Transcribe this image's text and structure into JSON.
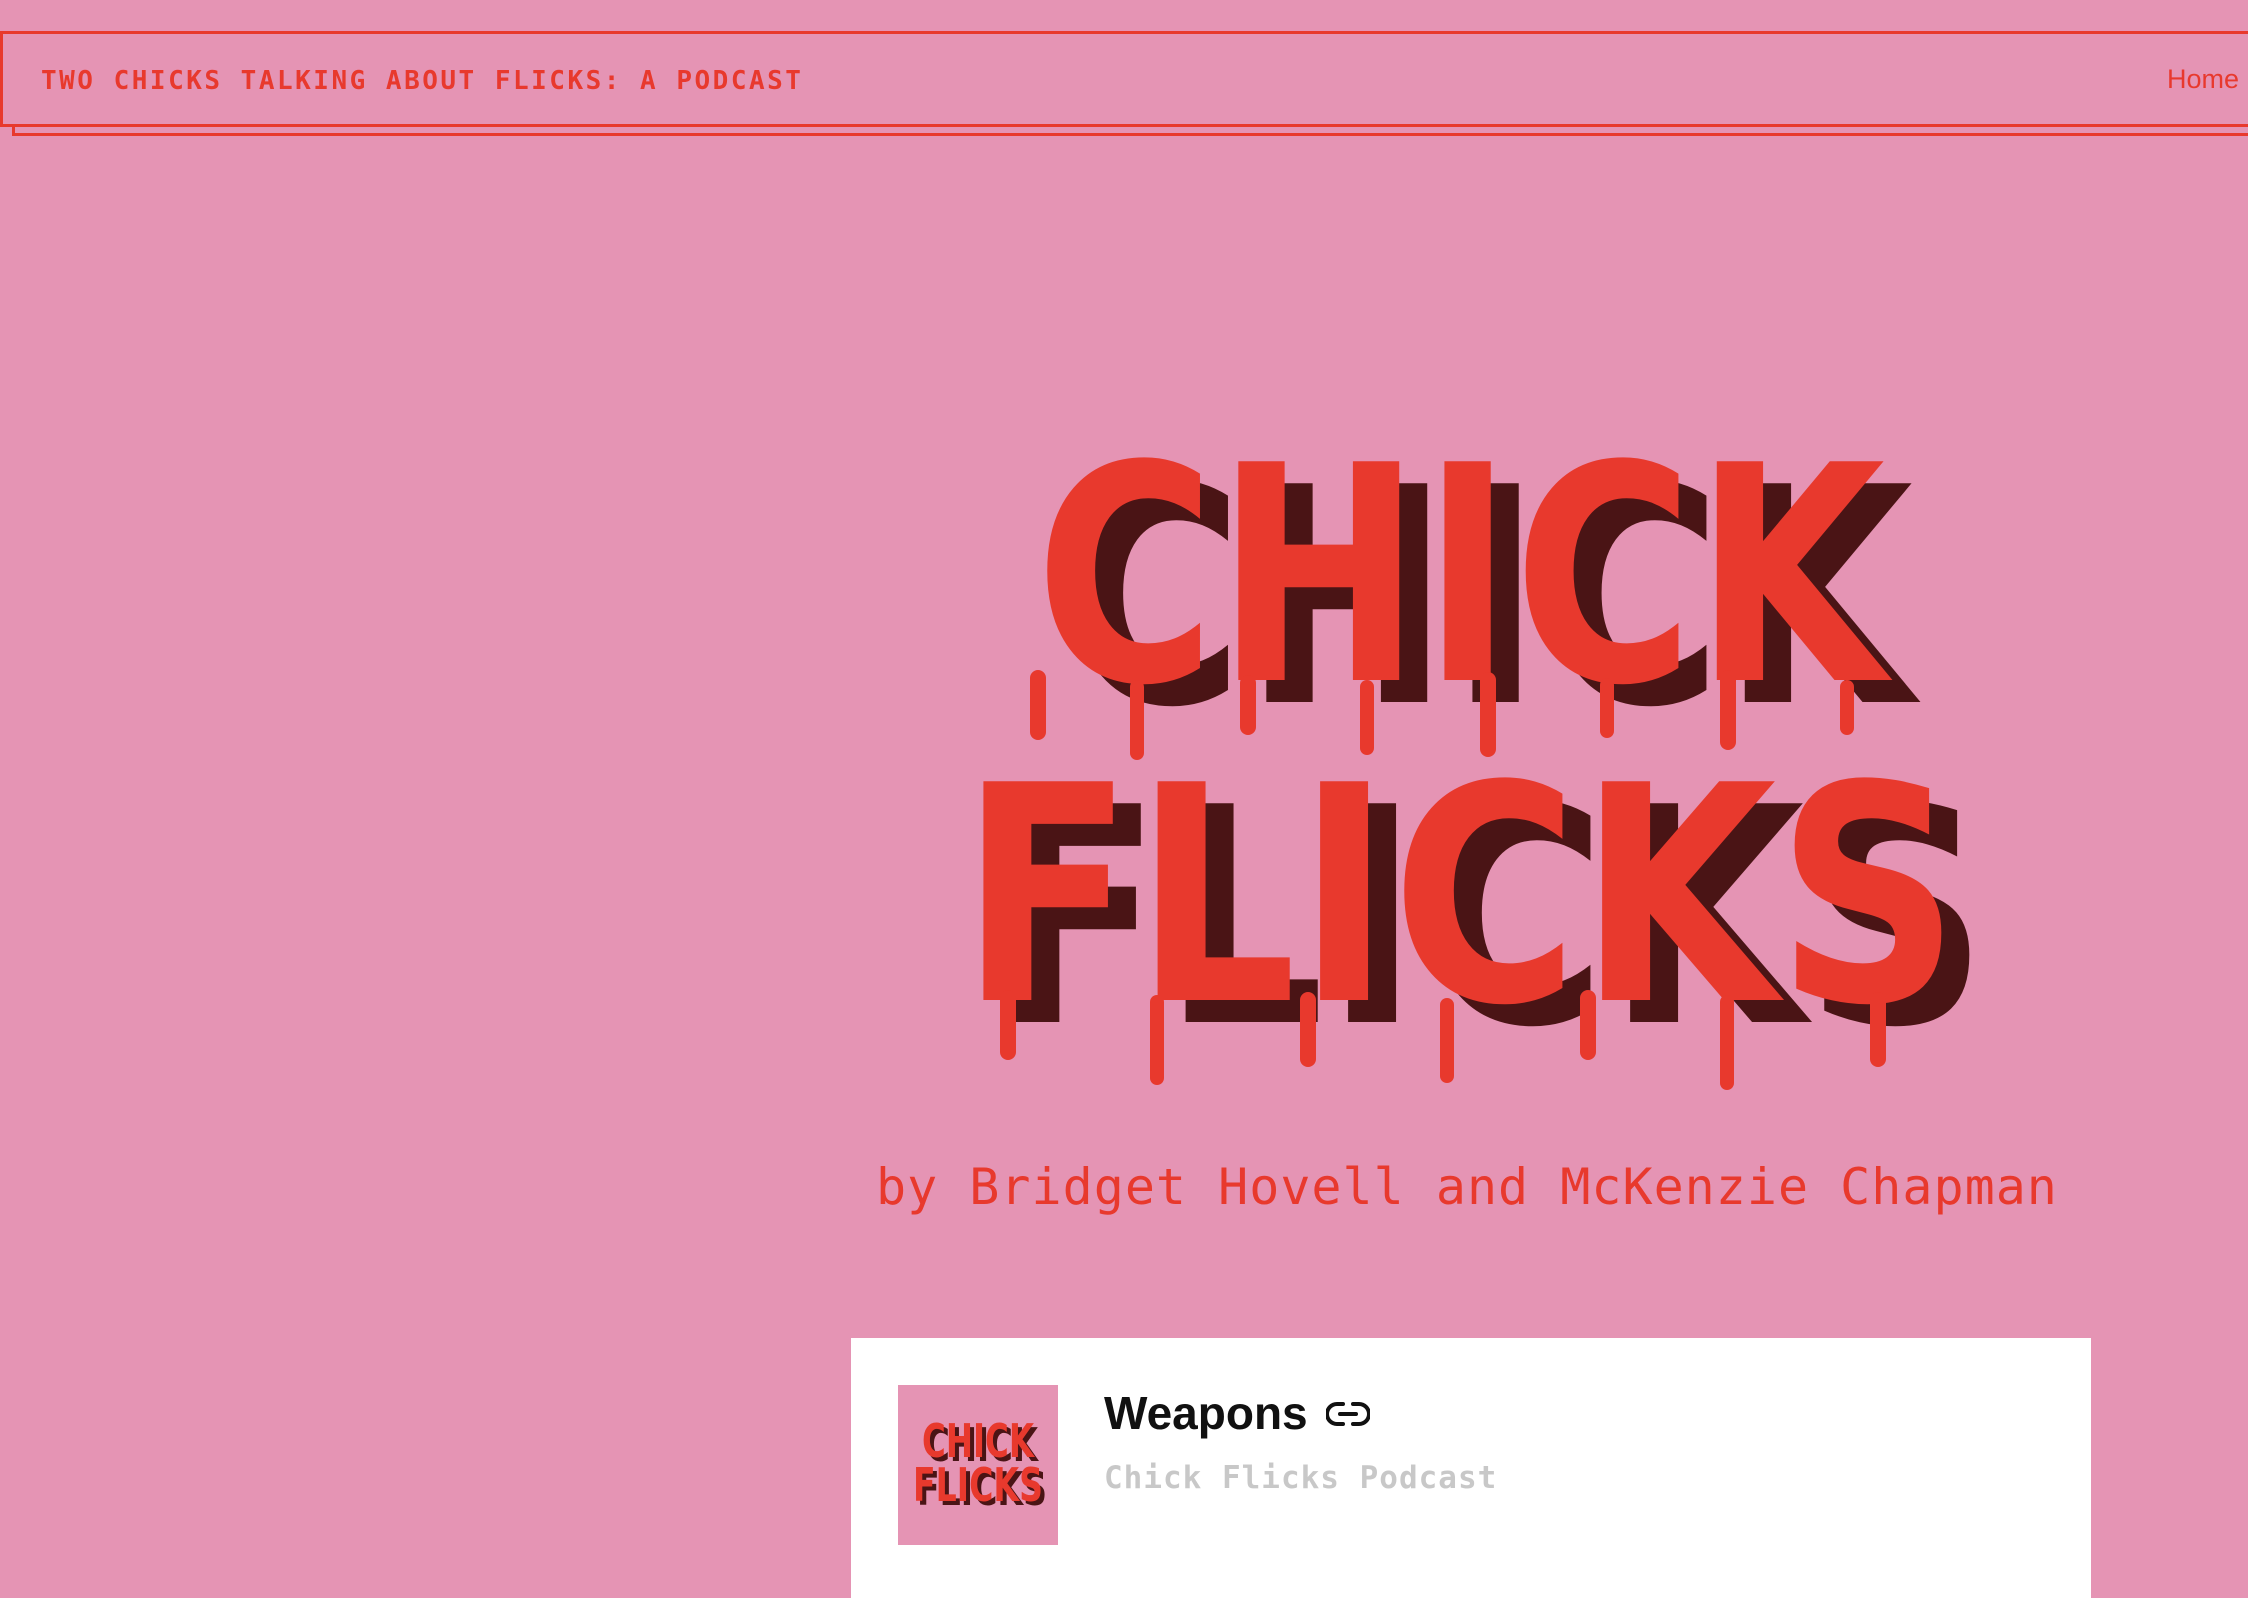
{
  "header": {
    "site_title": "TWO CHICKS TALKING ABOUT FLICKS: A PODCAST",
    "nav": {
      "home_label": "Home"
    }
  },
  "hero": {
    "logo_line1": "CHICK",
    "logo_line2": "FLICKS",
    "byline": "by Bridget Hovell and McKenzie Chapman"
  },
  "episode_card": {
    "title": "Weapons",
    "show_name": "Chick Flicks Podcast",
    "thumbnail_line1": "CHICK",
    "thumbnail_line2": "FLICKS",
    "link_icon": "link-icon"
  },
  "colors": {
    "background": "#e594b4",
    "accent_red": "#e8392d",
    "shadow_maroon": "#4a1415",
    "card_bg": "#ffffff",
    "muted_text": "#c8c8c8"
  }
}
